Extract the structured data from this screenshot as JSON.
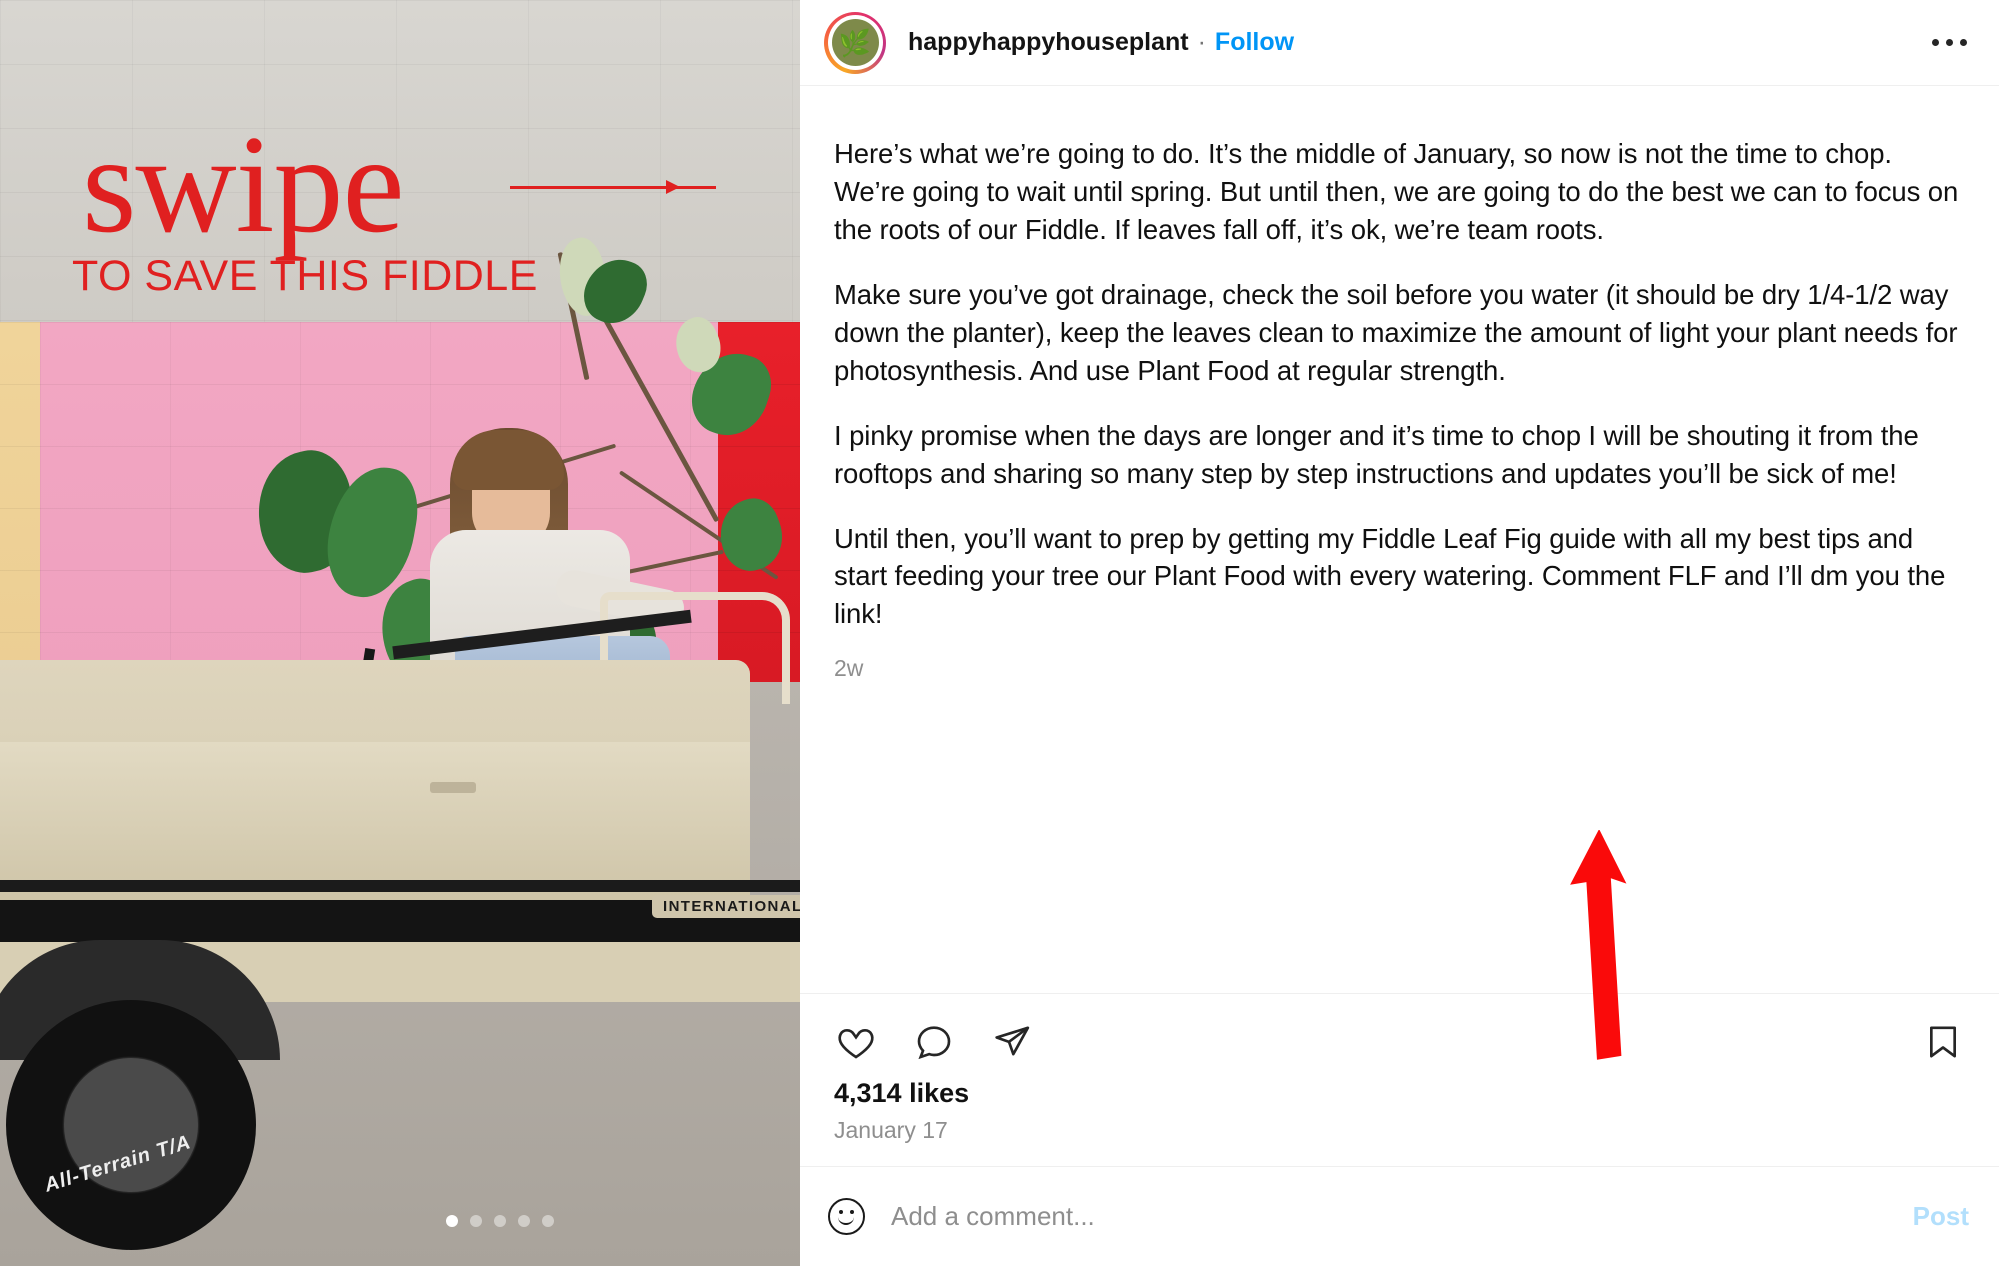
{
  "header": {
    "username": "happyhappyhouseplant",
    "separator": "·",
    "follow_label": "Follow",
    "avatar_glyph": "🌿",
    "more_icon": "more-options-icon"
  },
  "media": {
    "overlay_title": "swipe",
    "overlay_subtitle": "TO SAVE THIS FIDDLE",
    "truck_badge": "INTERNATIONAL",
    "tire_text": "All-Terrain T/A",
    "next_icon": "chevron-right-icon",
    "carousel": {
      "total": 5,
      "active_index": 0
    },
    "colors": {
      "overlay_red": "#e02020",
      "wall_gray": "#d4d1cb",
      "wall_tan": "#efd198",
      "wall_pink": "#f0a4c0",
      "wall_red": "#e2202a",
      "truck_cream": "#d9d0b5"
    }
  },
  "caption": {
    "paragraphs": [
      "Here’s what we’re going to do. It’s the middle of January, so now is not the time to chop. We’re going to wait until spring. But until then, we are going to do the best we can to focus on the roots of our Fiddle. If leaves fall off, it’s ok, we’re team roots.",
      "Make sure you’ve got drainage, check the soil before you water (it should be dry 1/4-1/2 way down the planter), keep the leaves clean to maximize the amount of light your plant needs for photosynthesis. And use Plant Food at regular strength.",
      "I pinky promise when the days are longer and it’s time to chop I will be shouting it from the rooftops and sharing so many step by step instructions and updates you’ll be sick of me!",
      "Until then, you’ll want to prep by getting my Fiddle Leaf Fig guide with all my best tips and start feeding your tree our Plant Food with every watering. Comment FLF and I’ll dm you the link!"
    ],
    "time_ago": "2w"
  },
  "actions": {
    "like_icon": "heart-icon",
    "comment_icon": "comment-icon",
    "share_icon": "share-icon",
    "save_icon": "bookmark-icon",
    "likes_text": "4,314 likes",
    "date_text": "January 17"
  },
  "comment_box": {
    "emoji_icon": "emoji-icon",
    "placeholder": "Add a comment...",
    "value": "",
    "post_label": "Post"
  },
  "annotation": {
    "type": "red-arrow",
    "color": "#fa0a0a",
    "points_at": "Comment FLF"
  }
}
